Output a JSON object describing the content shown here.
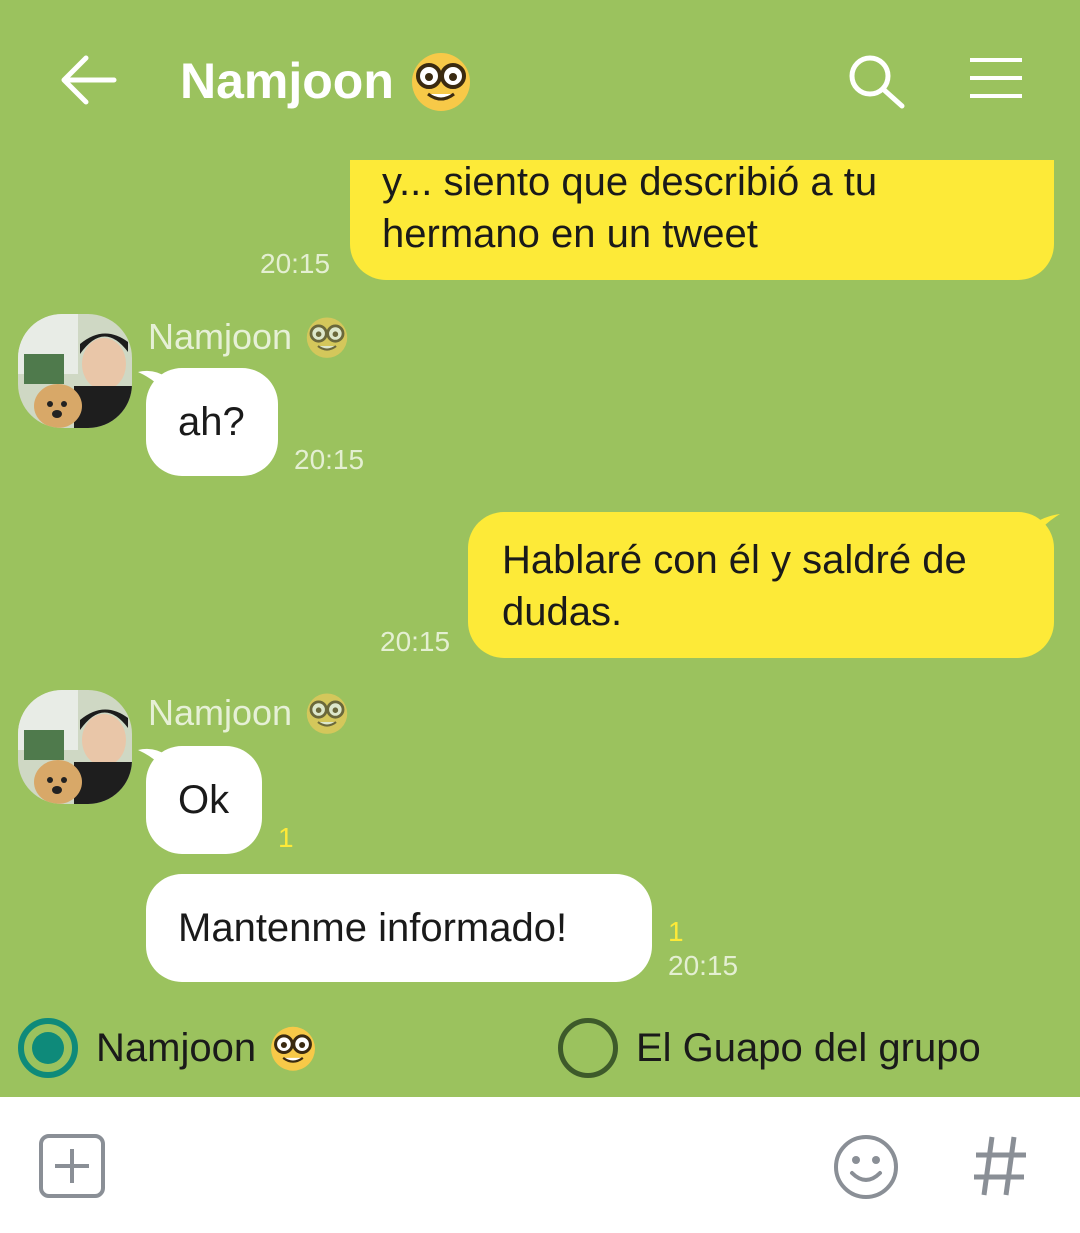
{
  "header": {
    "title": "Namjoon",
    "title_emoji": "nerd-face-emoji",
    "icons": [
      "back-arrow-icon",
      "search-icon",
      "menu-icon"
    ]
  },
  "messages": [
    {
      "from": "me",
      "text_line1": "y... siento que describió a tu",
      "text_line2": "hermano en un tweet",
      "time": "20:15"
    },
    {
      "from": "Namjoon",
      "sender": "Namjoon",
      "text": "ah?",
      "time": "20:15"
    },
    {
      "from": "me",
      "text_line1": "Hablaré con él y saldré de",
      "text_line2": "dudas.",
      "time": "20:15"
    },
    {
      "from": "Namjoon",
      "sender": "Namjoon",
      "text": "Ok",
      "read": "1"
    },
    {
      "from": "Namjoon",
      "text": "Mantenme informado!",
      "read": "1",
      "time": "20:15"
    }
  ],
  "speaker_select": {
    "options": [
      {
        "label": "Namjoon",
        "selected": true
      },
      {
        "label": "El Guapo del grupo",
        "selected": false
      }
    ]
  },
  "input_bar": {
    "icons": [
      "plus-icon",
      "emoji-icon",
      "hashtag-icon"
    ]
  },
  "colors": {
    "background": "#9bc25e",
    "my_bubble": "#fdea38",
    "their_bubble": "#ffffff",
    "radio_selected": "#0e8a7a"
  }
}
